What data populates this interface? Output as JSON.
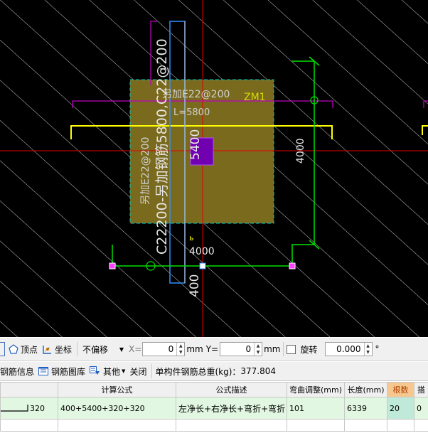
{
  "canvas": {
    "labels": {
      "top_rebar": "另加E22@200",
      "length": "L=5800",
      "zone": "ZM1",
      "vertical_rebar": "C22200-另加钢筋5800,C22@200",
      "side_rebar": "另加E22@200",
      "dim_vertical": "5400",
      "dim_right": "4000",
      "dim_bottom": "4000",
      "dim_lower": "400",
      "corner_mark": "ь"
    },
    "colors": {
      "background": "#000000",
      "hatch": "#ffffff",
      "slab_fill": "#7a6a1e",
      "slab_border": "#00c8c8",
      "axis": "#e00000",
      "rebar_magenta": "#c000c0",
      "rebar_yellow": "#ffff00",
      "dimension": "#00e000",
      "blue": "#3090ff",
      "column": "#7000b0"
    }
  },
  "toolbar1": {
    "items": [
      {
        "name": "vertex-button",
        "label": "顶点",
        "icon": "pentagon-icon"
      },
      {
        "name": "coordinate-button",
        "label": "坐标",
        "icon": "axes-icon"
      }
    ],
    "offset_select": "不偏移",
    "x_label": "X=",
    "x_value": "0",
    "x_unit": "mm",
    "y_label": "Y=",
    "y_value": "0",
    "y_unit": "mm",
    "rotate_label": "旋转",
    "rotate_value": "0.000",
    "degree_symbol": "°"
  },
  "toolbar2": {
    "rebar_info": "钢筋信息",
    "rebar_library": "钢筋图库",
    "other": "其他",
    "close": "关闭",
    "total_weight_label": "单构件钢筋总重(kg)：",
    "total_weight": "377.804"
  },
  "grid": {
    "headers": [
      "",
      "计算公式",
      "公式描述",
      "弯曲调整(mm)",
      "长度(mm)",
      "根数",
      "搭"
    ],
    "rows": [
      {
        "shape": "320",
        "formula": "400+5400+320+320",
        "description": "左净长+右净长+弯折+弯折",
        "bend_adjust": "101",
        "length": "6339",
        "count": "20",
        "lap": "0"
      }
    ]
  }
}
